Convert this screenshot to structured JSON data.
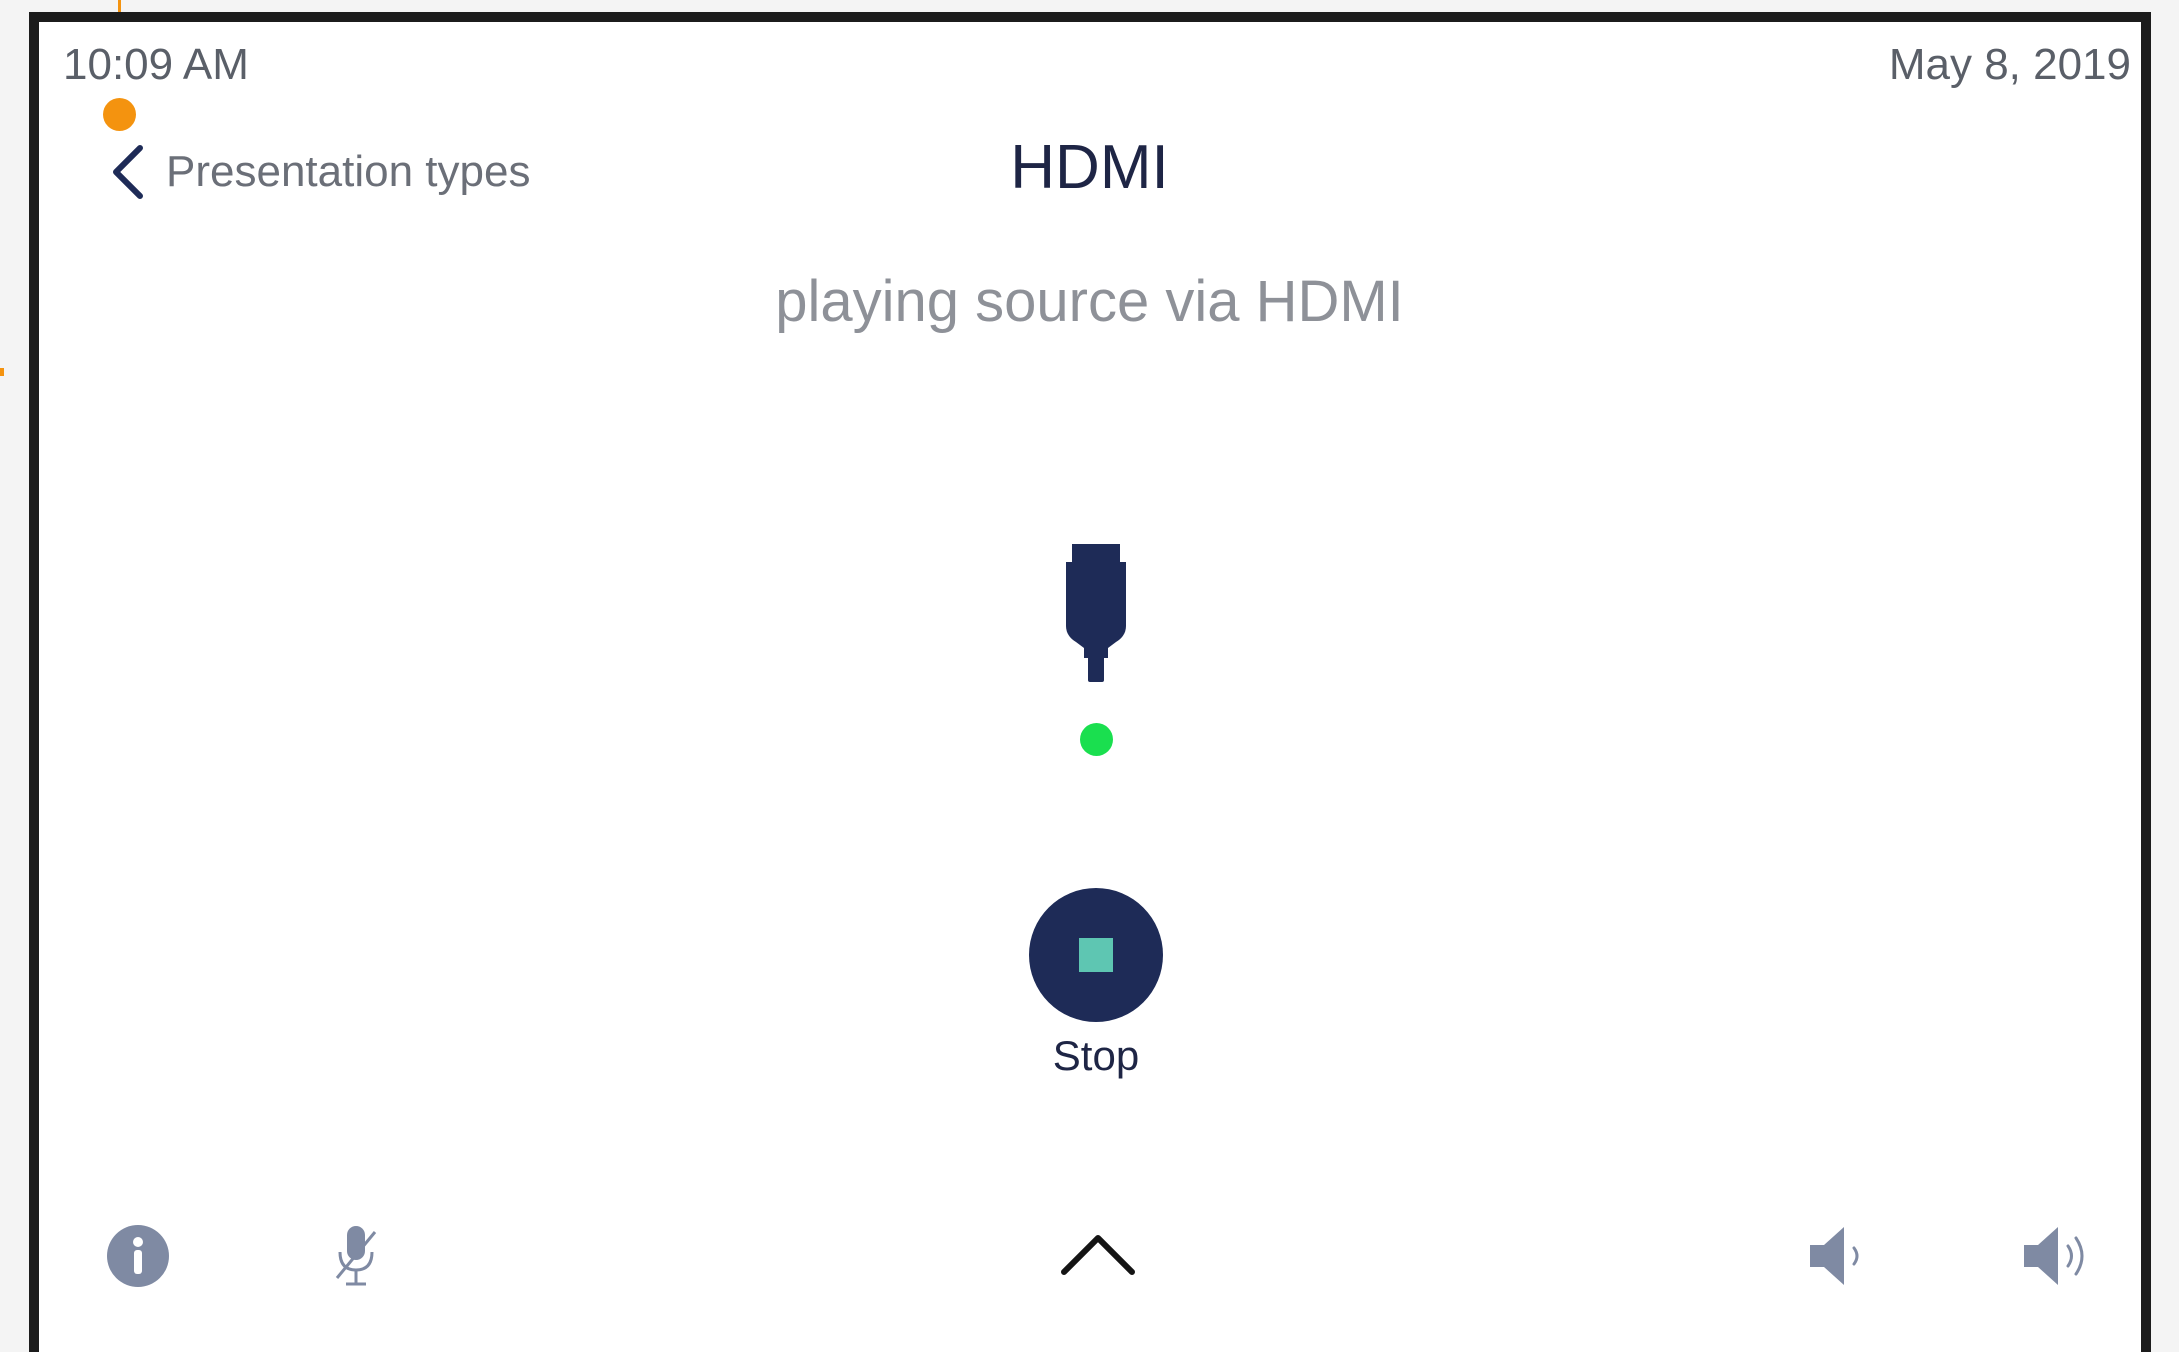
{
  "status_bar": {
    "time": "10:09 AM",
    "date": "May 8, 2019"
  },
  "nav": {
    "back_label": "Presentation types",
    "back_icon": "chevron-left-icon"
  },
  "header": {
    "title": "HDMI",
    "subtitle": "playing source via HDMI"
  },
  "source": {
    "icon": "hdmi-connector-icon",
    "status": "connected",
    "status_color": "#1adf4f"
  },
  "controls": {
    "stop_label": "Stop",
    "stop_button_color": "#1e2b57",
    "stop_icon_color": "#5ec6b2"
  },
  "bottom_bar": {
    "icons": [
      "info-icon",
      "microphone-muted-icon",
      "chevron-up-icon",
      "volume-down-icon",
      "volume-up-icon"
    ]
  },
  "colors": {
    "accent_navy": "#1e2b57",
    "annotation_orange": "#f4930f"
  }
}
